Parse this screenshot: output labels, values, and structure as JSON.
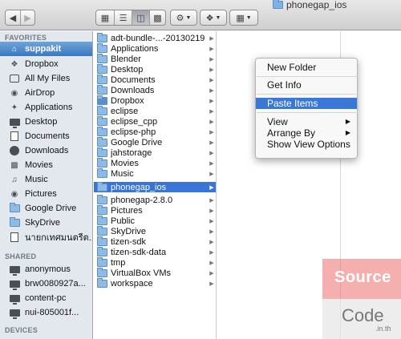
{
  "window": {
    "title": "phonegap_ios"
  },
  "toolbar": {
    "back_icon": "chevron-left-icon",
    "forward_icon": "chevron-right-icon",
    "view_modes": [
      "icon-view",
      "list-view",
      "column-view",
      "coverflow-view"
    ],
    "active_view": "column-view",
    "action_icon": "gear-icon",
    "dropbox_icon": "dropbox-icon",
    "arrange_icon": "grid-icon"
  },
  "sidebar": {
    "favorites_header": "FAVORITES",
    "favorites": [
      {
        "label": "suppakit",
        "icon": "home-icon",
        "selected": true
      },
      {
        "label": "Dropbox",
        "icon": "dropbox-icon"
      },
      {
        "label": "All My Files",
        "icon": "files-icon"
      },
      {
        "label": "AirDrop",
        "icon": "airdrop-icon"
      },
      {
        "label": "Applications",
        "icon": "applications-icon"
      },
      {
        "label": "Desktop",
        "icon": "desktop-icon"
      },
      {
        "label": "Documents",
        "icon": "documents-icon"
      },
      {
        "label": "Downloads",
        "icon": "downloads-icon"
      },
      {
        "label": "Movies",
        "icon": "movies-icon"
      },
      {
        "label": "Music",
        "icon": "music-icon"
      },
      {
        "label": "Pictures",
        "icon": "pictures-icon"
      },
      {
        "label": "Google Drive",
        "icon": "folder-icon"
      },
      {
        "label": "SkyDrive",
        "icon": "folder-icon"
      },
      {
        "label": "นายกเทศมนตรีต...",
        "icon": "document-icon"
      }
    ],
    "shared_header": "SHARED",
    "shared": [
      {
        "label": "anonymous",
        "icon": "computer-icon"
      },
      {
        "label": "brw0080927a...",
        "icon": "computer-icon"
      },
      {
        "label": "content-pc",
        "icon": "computer-icon"
      },
      {
        "label": "nui-805001f...",
        "icon": "computer-icon"
      }
    ],
    "devices_header": "DEVICES"
  },
  "column1": {
    "items": [
      {
        "label": "adt-bundle-...-20130219",
        "has_children": true
      },
      {
        "label": "Applications",
        "has_children": true
      },
      {
        "label": "Blender",
        "has_children": true
      },
      {
        "label": "Desktop",
        "has_children": true
      },
      {
        "label": "Documents",
        "has_children": true
      },
      {
        "label": "Downloads",
        "has_children": true
      },
      {
        "label": "Dropbox",
        "has_children": true,
        "icon": "dropbox-folder-icon"
      },
      {
        "label": "eclipse",
        "has_children": true
      },
      {
        "label": "eclipse_cpp",
        "has_children": true
      },
      {
        "label": "eclipse-php",
        "has_children": true
      },
      {
        "label": "Google Drive",
        "has_children": true
      },
      {
        "label": "jahstorage",
        "has_children": true
      },
      {
        "label": "Movies",
        "has_children": true
      },
      {
        "label": "Music",
        "has_children": true
      },
      {
        "label": "phonegap_ios",
        "has_children": true,
        "selected": true
      },
      {
        "label": "phonegap-2.8.0",
        "has_children": true
      },
      {
        "label": "Pictures",
        "has_children": true
      },
      {
        "label": "Public",
        "has_children": true
      },
      {
        "label": "SkyDrive",
        "has_children": true
      },
      {
        "label": "tizen-sdk",
        "has_children": true
      },
      {
        "label": "tizen-sdk-data",
        "has_children": true
      },
      {
        "label": "tmp",
        "has_children": true
      },
      {
        "label": "VirtualBox VMs",
        "has_children": true
      },
      {
        "label": "workspace",
        "has_children": true
      }
    ]
  },
  "context_menu": {
    "new_folder": "New Folder",
    "get_info": "Get Info",
    "paste_items": "Paste Items",
    "view": "View",
    "arrange_by": "Arrange By",
    "show_view_options": "Show View Options",
    "highlighted": "Paste Items"
  },
  "watermark": {
    "line1": "Source",
    "line2": "Code",
    "suffix": ".in.th"
  },
  "colors": {
    "selection": "#3875d7",
    "sidebar_bg": "#e3e8ee",
    "menu_highlight": "#3a78d8",
    "watermark_red": "#ee6e6e"
  }
}
